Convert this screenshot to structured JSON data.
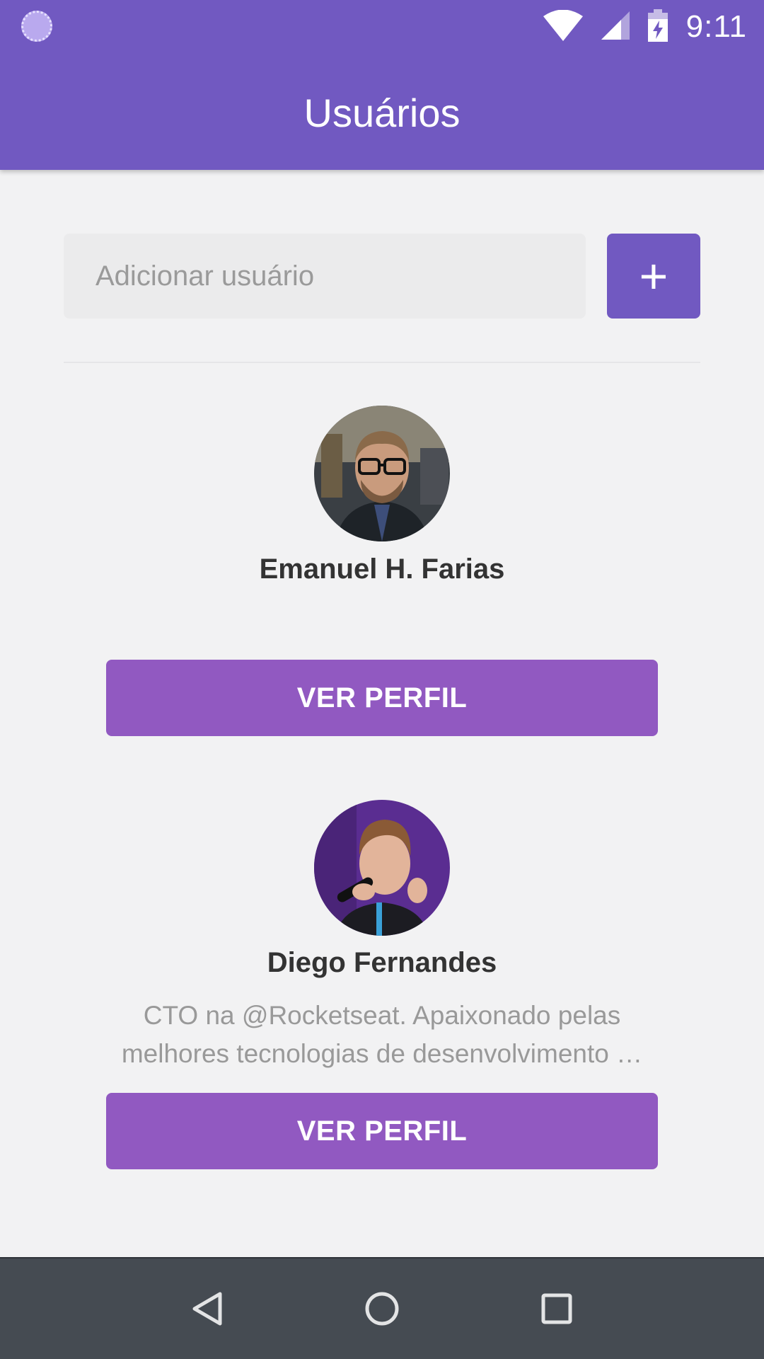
{
  "status_bar": {
    "time": "9:11",
    "icons": [
      "loading-icon",
      "wifi-icon",
      "signal-icon",
      "battery-charging-icon"
    ]
  },
  "app_bar": {
    "title": "Usuários"
  },
  "add_form": {
    "placeholder": "Adicionar usuário",
    "add_button_icon": "plus-icon",
    "add_button_glyph": "+"
  },
  "users": [
    {
      "name": "Emanuel H. Farias",
      "bio": "",
      "button_label": "VER PERFIL"
    },
    {
      "name": "Diego Fernandes",
      "bio": "CTO na @Rocketseat. Apaixonado pelas melhores tecnologias de desenvolvimento …",
      "button_label": "VER PERFIL"
    }
  ],
  "nav_bar": {
    "buttons": [
      "back-icon",
      "home-icon",
      "recents-icon"
    ]
  },
  "colors": {
    "primary": "#7159c1",
    "button": "#9159c1",
    "nav": "#454b52",
    "background": "#f2f2f3"
  }
}
